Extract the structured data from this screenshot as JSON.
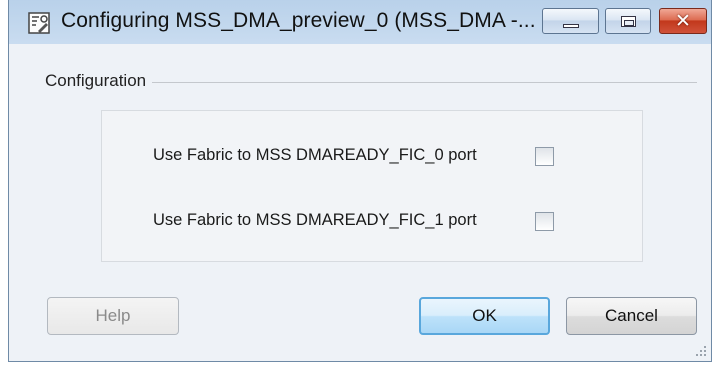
{
  "window": {
    "title": "Configuring MSS_DMA_preview_0 (MSS_DMA -...",
    "icon": "config-icon"
  },
  "group": {
    "label": "Configuration"
  },
  "options": [
    {
      "label": "Use Fabric to MSS DMAREADY_FIC_0 port",
      "checked": false
    },
    {
      "label": "Use Fabric to MSS DMAREADY_FIC_1 port",
      "checked": false
    }
  ],
  "buttons": {
    "help": "Help",
    "ok": "OK",
    "cancel": "Cancel"
  },
  "colors": {
    "close_button": "#c2381c",
    "default_button_border": "#59a7dc"
  }
}
